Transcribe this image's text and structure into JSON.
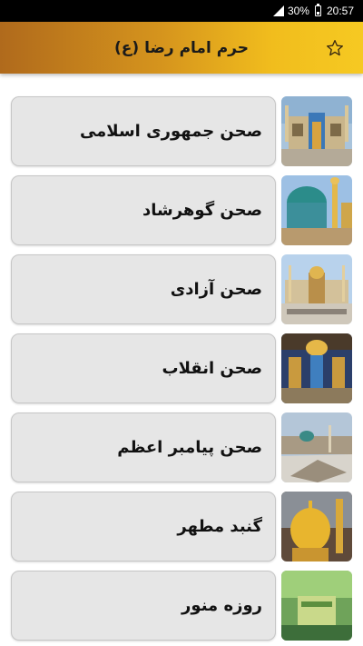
{
  "status_bar": {
    "battery": "30%",
    "time": "20:57"
  },
  "app_bar": {
    "title": "حرم امام رضا (ع)",
    "star_icon": "star-outline-icon"
  },
  "items": [
    {
      "label": "صحن جمهوری اسلامی",
      "image": "courtyard-islamic-republic"
    },
    {
      "label": "صحن گوهرشاد",
      "image": "courtyard-goharshad"
    },
    {
      "label": "صحن آزادی",
      "image": "courtyard-azadi"
    },
    {
      "label": "صحن انقلاب",
      "image": "courtyard-enghelab"
    },
    {
      "label": "صحن پیامبر اعظم",
      "image": "courtyard-payambar-azam"
    },
    {
      "label": "گنبد مطهر",
      "image": "holy-dome"
    },
    {
      "label": "روزه منور",
      "image": "illuminated-tomb"
    }
  ],
  "colors": {
    "app_bar_start": "#b06a1c",
    "app_bar_end": "#f6c922",
    "card_bg": "#e6e6e6"
  }
}
